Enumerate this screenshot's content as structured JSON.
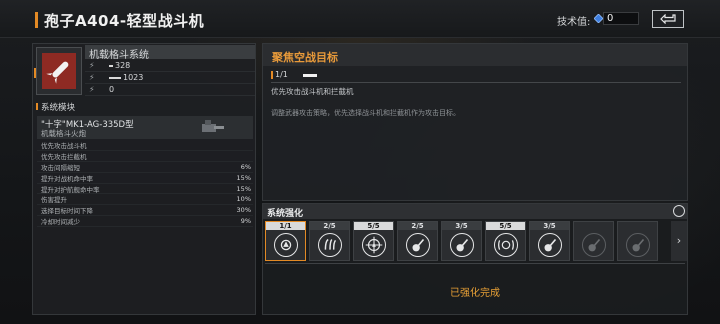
{
  "header": {
    "title": "孢子A404-轻型战斗机",
    "tech_label": "技术值:",
    "tech_value": "0",
    "back_icon": "back-arrow-icon"
  },
  "weapon": {
    "name": "机载格斗系统",
    "icon": "missile-icon",
    "accent_color": "#8e2a23",
    "stats": [
      {
        "icon": "stat-icon",
        "value": "328"
      },
      {
        "icon": "stat-icon",
        "value": "1023"
      },
      {
        "icon": "stat-icon",
        "value": "0"
      }
    ]
  },
  "modules": {
    "header": "系统模块",
    "card": {
      "name": "\"十字\"MK1-AG-335D型",
      "sub": "机载格斗火炮"
    },
    "effects": [
      {
        "name": "优先攻击战斗机",
        "value": ""
      },
      {
        "name": "优先攻击拦截机",
        "value": ""
      },
      {
        "name": "攻击间隔缩短",
        "value": "6%"
      },
      {
        "name": "提升对战机命中率",
        "value": "15%"
      },
      {
        "name": "提升对护航舰命中率",
        "value": "15%"
      },
      {
        "name": "伤害提升",
        "value": "10%"
      },
      {
        "name": "选择目标时间下降",
        "value": "30%"
      },
      {
        "name": "冷却时间减少",
        "value": "9%"
      }
    ]
  },
  "focus": {
    "title": "聚焦空战目标",
    "level": "1/1",
    "desc1": "优先攻击战斗机和拦截机",
    "desc2": "调整武器攻击策略，优先选择战斗机和拦截机作为攻击目标。"
  },
  "enhance": {
    "title": "系统强化",
    "refresh_icon": "refresh-icon",
    "slots": [
      {
        "label": "1/1",
        "icon": "target-icon",
        "style": "light",
        "selected": true,
        "locked": false
      },
      {
        "label": "2/5",
        "icon": "claw-icon",
        "style": "dark",
        "selected": false,
        "locked": false
      },
      {
        "label": "5/5",
        "icon": "crosshair-icon",
        "style": "light",
        "selected": false,
        "locked": false
      },
      {
        "label": "2/5",
        "icon": "guitar-icon",
        "style": "dark",
        "selected": false,
        "locked": false
      },
      {
        "label": "3/5",
        "icon": "guitar-icon",
        "style": "dark",
        "selected": false,
        "locked": false
      },
      {
        "label": "5/5",
        "icon": "radar-icon",
        "style": "light",
        "selected": false,
        "locked": false
      },
      {
        "label": "3/5",
        "icon": "guitar-icon",
        "style": "dark",
        "selected": false,
        "locked": false
      },
      {
        "label": "",
        "icon": "guitar-icon",
        "style": "none",
        "selected": false,
        "locked": true
      },
      {
        "label": "",
        "icon": "guitar-icon",
        "style": "none",
        "selected": false,
        "locked": true
      }
    ],
    "arrow": "›",
    "done_text": "已强化完成"
  }
}
